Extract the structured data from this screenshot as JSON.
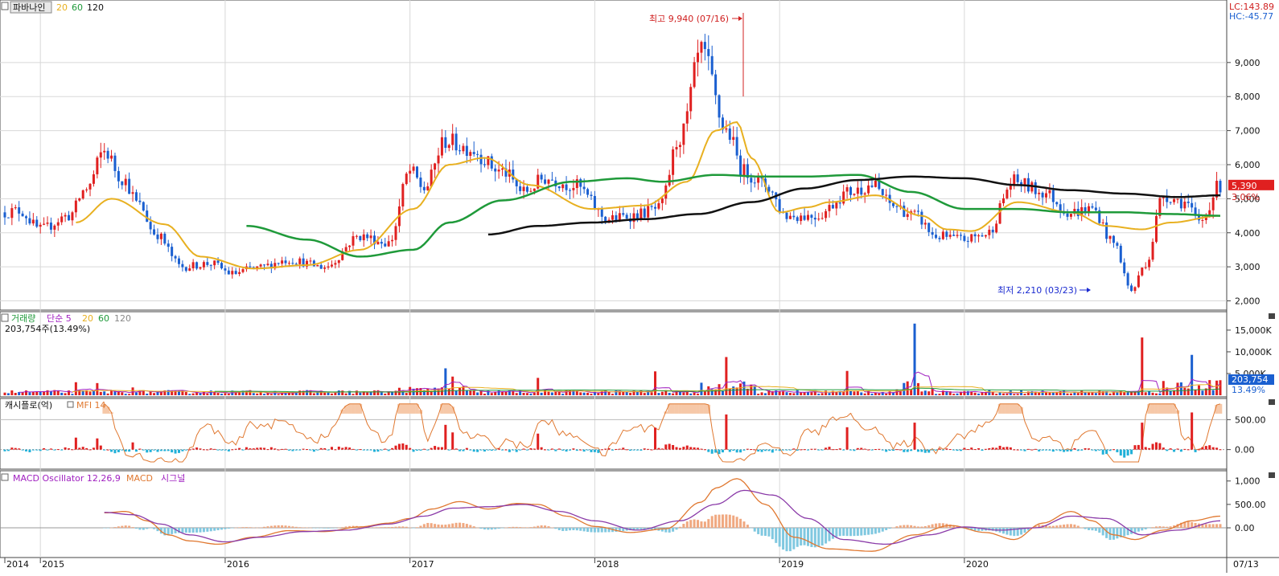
{
  "colors": {
    "up": "#e02020",
    "down": "#1a5fd0",
    "ma20": "#e8b020",
    "ma60": "#1f9a3a",
    "ma120": "#111111",
    "mfi": "#e07830",
    "macd": "#e07830",
    "signal": "#8a3aa8",
    "osc_pos": "#f0a880",
    "osc_neg": "#80c8e0",
    "cash_pos": "#e02020",
    "cash_neg": "#20b0d8",
    "grid": "#d8d8d8",
    "annot_high": "#d02020",
    "annot_low": "#1a2ad0"
  },
  "price_panel": {
    "stock_name": "파바나인",
    "ma_labels": [
      "20",
      "60",
      "120"
    ],
    "lc_label": "LC:143.89",
    "hc_label": "HC:-45.77",
    "last_price_label": "5,390",
    "change_pct_label": "3.06%",
    "high_annotation": "최고 9,940 (07/16)",
    "low_annotation": "최저 2,210 (03/23)"
  },
  "volume_panel": {
    "title": "거래량",
    "ma_label": "단순 5",
    "ma_periods": [
      "20",
      "60",
      "120"
    ],
    "summary": "203,754주(13.49%)",
    "last_value_label": "203,754",
    "last_pct_label": "13.49%"
  },
  "cash_panel": {
    "title": "캐시플로(억)",
    "mfi_label": "MFI 14"
  },
  "macd_panel": {
    "title": "MACD Oscillator 12,26,9",
    "macd_label": "MACD",
    "signal_label": "시그널"
  },
  "x_axis": {
    "end_label": "07/13"
  },
  "chart_data": [
    {
      "type": "candlestick",
      "frequency": "weekly",
      "x_tick_labels": [
        "2014",
        "2015",
        "2016",
        "2017",
        "2018",
        "2019",
        "2020"
      ],
      "y_tick_labels": [
        "2,000",
        "3,000",
        "4,000",
        "5,000",
        "6,000",
        "7,000",
        "8,000",
        "9,000"
      ],
      "ylim": [
        1800,
        10600
      ],
      "price_anchors": {
        "week_index": [
          0,
          4,
          10,
          18,
          23,
          28,
          33,
          38,
          42,
          50,
          58,
          64,
          70,
          80,
          90,
          100,
          108,
          114,
          118,
          124,
          130,
          140,
          146,
          152,
          160,
          170,
          176,
          184,
          190,
          196,
          203,
          208,
          214,
          220,
          228,
          238,
          244,
          250,
          256,
          262,
          270,
          276,
          284,
          292,
          300,
          306,
          312,
          317,
          321,
          326,
          332,
          336,
          342
        ],
        "close": [
          4600,
          4650,
          4100,
          4500,
          5300,
          6400,
          5600,
          4800,
          4000,
          3000,
          3100,
          2800,
          2950,
          3200,
          3000,
          3900,
          3700,
          5800,
          5300,
          6700,
          6500,
          5800,
          5200,
          5600,
          5400,
          4400,
          4500,
          4700,
          6800,
          9300,
          7000,
          5800,
          5400,
          4500,
          4500,
          5200,
          5400,
          4800,
          4500,
          3900,
          3800,
          3950,
          5500,
          5200,
          4600,
          4700,
          3700,
          2300,
          3100,
          5100,
          4900,
          4300,
          5390
        ]
      },
      "ma20_anchors": {
        "week_index": [
          20,
          30,
          45,
          55,
          70,
          85,
          100,
          115,
          125,
          135,
          148,
          165,
          180,
          192,
          200,
          206,
          210,
          218,
          226,
          232,
          245,
          258,
          265,
          272,
          285,
          300,
          310,
          320,
          328,
          342
        ],
        "value": [
          4300,
          5000,
          4250,
          3300,
          2950,
          3050,
          3500,
          4700,
          6000,
          6200,
          5400,
          4700,
          4800,
          5500,
          7000,
          7250,
          6200,
          4600,
          4750,
          4900,
          5100,
          4500,
          4100,
          4050,
          4900,
          4600,
          4200,
          4100,
          4300,
          4500
        ]
      },
      "ma60_anchors": {
        "week_index": [
          68,
          85,
          100,
          115,
          125,
          140,
          160,
          175,
          185,
          200,
          214,
          225,
          240,
          255,
          270,
          285,
          300,
          315,
          328,
          342
        ],
        "value": [
          4200,
          3800,
          3300,
          3500,
          4300,
          4950,
          5500,
          5600,
          5500,
          5700,
          5650,
          5650,
          5700,
          5200,
          4700,
          4700,
          4600,
          4600,
          4550,
          4500
        ]
      },
      "ma120_anchors": {
        "week_index": [
          136,
          150,
          165,
          180,
          195,
          210,
          225,
          240,
          255,
          270,
          285,
          300,
          315,
          330,
          342
        ],
        "value": [
          3950,
          4200,
          4300,
          4400,
          4550,
          4900,
          5300,
          5550,
          5650,
          5600,
          5400,
          5250,
          5150,
          5050,
          5100
        ]
      }
    },
    {
      "type": "bar",
      "series_name": "거래량",
      "y_tick_labels": [
        "5,000K",
        "10,000K",
        "15,000K"
      ],
      "ylim": [
        0,
        18500
      ],
      "unit": "K",
      "spikes": {
        "week_index": [
          20,
          26,
          36,
          124,
          126,
          150,
          183,
          203,
          237,
          256,
          320,
          334
        ],
        "value": [
          3000,
          2800,
          1800,
          6200,
          4300,
          4000,
          5500,
          8800,
          5600,
          16500,
          13300,
          9300
        ]
      }
    },
    {
      "type": "bar",
      "series_name": "캐시플로(억)",
      "y_tick_labels": [
        "0.00",
        "500.00"
      ],
      "ylim": [
        -300,
        800
      ]
    },
    {
      "type": "bar",
      "series_name": "MACD Oscillator",
      "y_tick_labels": [
        "0.00",
        "500.00",
        "1,000"
      ],
      "ylim": [
        -600,
        1150
      ],
      "macd_anchors": {
        "week_index": [
          28,
          34,
          40,
          46,
          52,
          60,
          70,
          80,
          90,
          100,
          108,
          114,
          120,
          128,
          136,
          144,
          150,
          158,
          166,
          176,
          186,
          196,
          200,
          206,
          214,
          222,
          232,
          244,
          256,
          266,
          276,
          284,
          292,
          300,
          306,
          312,
          318,
          326,
          334,
          342
        ],
        "value": [
          320,
          350,
          150,
          -150,
          -280,
          -350,
          -200,
          -60,
          -80,
          20,
          100,
          200,
          400,
          560,
          400,
          520,
          500,
          250,
          30,
          -100,
          -20,
          550,
          850,
          1050,
          500,
          -200,
          -450,
          -500,
          -150,
          50,
          -100,
          -250,
          100,
          350,
          150,
          -150,
          -250,
          -50,
          150,
          250
        ]
      },
      "signal_anchors": {
        "week_index": [
          28,
          36,
          44,
          52,
          62,
          72,
          84,
          96,
          108,
          118,
          126,
          136,
          146,
          156,
          166,
          178,
          190,
          200,
          208,
          216,
          226,
          236,
          248,
          260,
          270,
          280,
          290,
          300,
          310,
          320,
          330,
          342
        ],
        "value": [
          330,
          280,
          80,
          -150,
          -300,
          -200,
          -80,
          -50,
          80,
          250,
          420,
          450,
          500,
          350,
          150,
          -50,
          150,
          500,
          800,
          700,
          200,
          -250,
          -350,
          -150,
          20,
          -50,
          0,
          250,
          200,
          -150,
          -50,
          150
        ]
      }
    }
  ]
}
